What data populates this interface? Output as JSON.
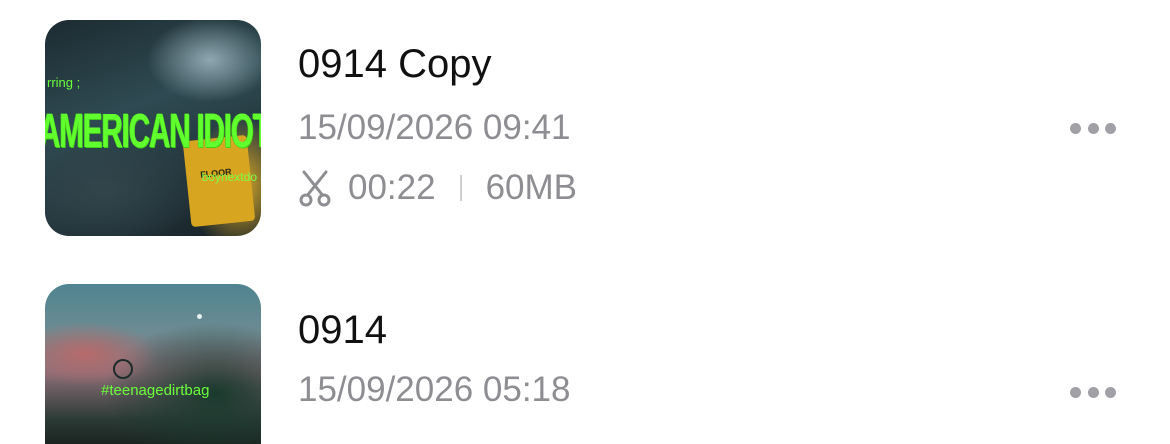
{
  "recordings": [
    {
      "title": "0914 Copy",
      "date": "15/09/2026 09:41",
      "duration": "00:22",
      "size": "60MB",
      "thumbnail": {
        "overlay_starring": "rring ;",
        "overlay_title": "AMERICAN IDIOT",
        "overlay_credit": "boynextdo",
        "sign_text": "FLOOR"
      },
      "icons": {
        "trim": "scissors-icon",
        "more": "more-dots-icon"
      }
    },
    {
      "title": "0914",
      "date": "15/09/2026 05:18",
      "thumbnail": {
        "overlay_hashtag": "#teenagedirtbag"
      },
      "icons": {
        "more": "more-dots-icon"
      }
    }
  ],
  "colors": {
    "title": "#111111",
    "secondary_text": "#8d8d92",
    "more_dots": "#a0a0a6",
    "overlay_green": "#62ff2e"
  }
}
